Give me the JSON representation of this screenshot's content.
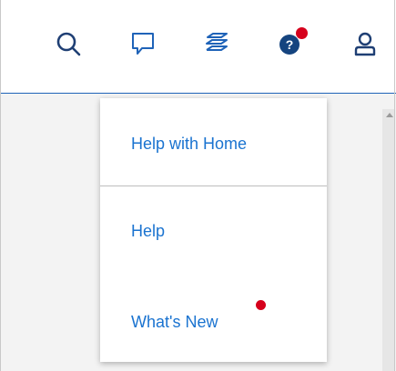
{
  "toolbar": {
    "icons": [
      {
        "name": "search-icon"
      },
      {
        "name": "chat-icon"
      },
      {
        "name": "layers-icon"
      },
      {
        "name": "help-icon",
        "has_notification": true
      },
      {
        "name": "user-icon"
      }
    ],
    "accent_color": "#1f63b8",
    "notification_color": "#d6001c"
  },
  "help_menu": {
    "items": [
      {
        "label": "Help with Home"
      },
      {
        "label": "Help"
      },
      {
        "label": "What's New",
        "has_notification": true
      }
    ],
    "link_color": "#1a73d0"
  }
}
